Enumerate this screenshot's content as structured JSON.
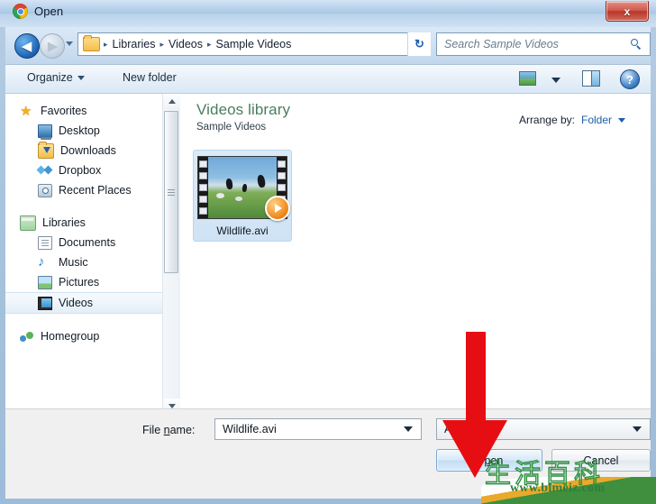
{
  "window": {
    "title": "Open",
    "app_icon": "chrome-icon",
    "close_label": "x"
  },
  "navigation": {
    "back_glyph": "◀",
    "forward_glyph": "▶",
    "breadcrumb": [
      "Libraries",
      "Videos",
      "Sample Videos"
    ],
    "breadcrumb_separator": "▸",
    "refresh_glyph": "↻",
    "folder_icon": "folder-icon",
    "history_icon": "chevron-down-icon"
  },
  "search": {
    "placeholder": "Search Sample Videos",
    "icon": "search-icon"
  },
  "toolbar": {
    "organize_label": "Organize",
    "new_folder_label": "New folder",
    "view_icon": "change-view-icon",
    "view_caret_icon": "chevron-down-icon",
    "preview_pane_icon": "preview-pane-icon",
    "help_label": "?",
    "help_icon": "help-icon"
  },
  "sidebar": {
    "groups": [
      {
        "header": {
          "label": "Favorites",
          "icon": "star-icon",
          "icon_class": "ic-star"
        },
        "items": [
          {
            "label": "Desktop",
            "icon": "desktop-icon",
            "icon_class": "ic-desktop"
          },
          {
            "label": "Downloads",
            "icon": "downloads-folder-icon",
            "icon_class": "ic-folder"
          },
          {
            "label": "Dropbox",
            "icon": "dropbox-icon",
            "icon_class": "ic-dropbox"
          },
          {
            "label": "Recent Places",
            "icon": "recent-places-icon",
            "icon_class": "ic-recent"
          }
        ]
      },
      {
        "header": {
          "label": "Libraries",
          "icon": "libraries-icon",
          "icon_class": "ic-libs"
        },
        "items": [
          {
            "label": "Documents",
            "icon": "documents-icon",
            "icon_class": "ic-doc"
          },
          {
            "label": "Music",
            "icon": "music-note-icon",
            "icon_class": "ic-music"
          },
          {
            "label": "Pictures",
            "icon": "pictures-icon",
            "icon_class": "ic-pics"
          },
          {
            "label": "Videos",
            "icon": "videos-icon",
            "icon_class": "ic-video",
            "selected": true
          }
        ]
      },
      {
        "header": {
          "label": "Homegroup",
          "icon": "homegroup-icon",
          "icon_class": "ic-home"
        },
        "items": []
      }
    ],
    "scrollbar": {
      "up_icon": "scroll-up-arrow-icon",
      "down_icon": "scroll-down-arrow-icon"
    }
  },
  "content": {
    "library_title": "Videos library",
    "library_subtitle": "Sample Videos",
    "arrange_label": "Arrange by:",
    "arrange_value": "Folder",
    "files": [
      {
        "name": "Wildlife.avi",
        "type": "video",
        "selected": true,
        "overlay_icon": "play-badge-icon"
      }
    ]
  },
  "bottom": {
    "file_name_label_pre": "File ",
    "file_name_label_key": "n",
    "file_name_label_post": "ame:",
    "file_name_value": "Wildlife.avi",
    "file_type_value": "All",
    "open_button_pre": "O",
    "open_button_key": "p",
    "open_button_post": "en",
    "cancel_button": "Cancel"
  },
  "annotation": {
    "arrow": {
      "color": "#e60e12",
      "direction": "down",
      "points_at": "open-button"
    }
  },
  "watermark": {
    "cn_text": "生活百科",
    "url": "www.bimeiz.com",
    "stroke_color": "#2f9140",
    "url_color": "#2f7d3a"
  },
  "colors": {
    "frame": "#a8c4de",
    "title_text": "#0d1a2b",
    "library_title": "#4a7d5f",
    "link": "#1a5fa8",
    "close_button": "#b8372a"
  }
}
